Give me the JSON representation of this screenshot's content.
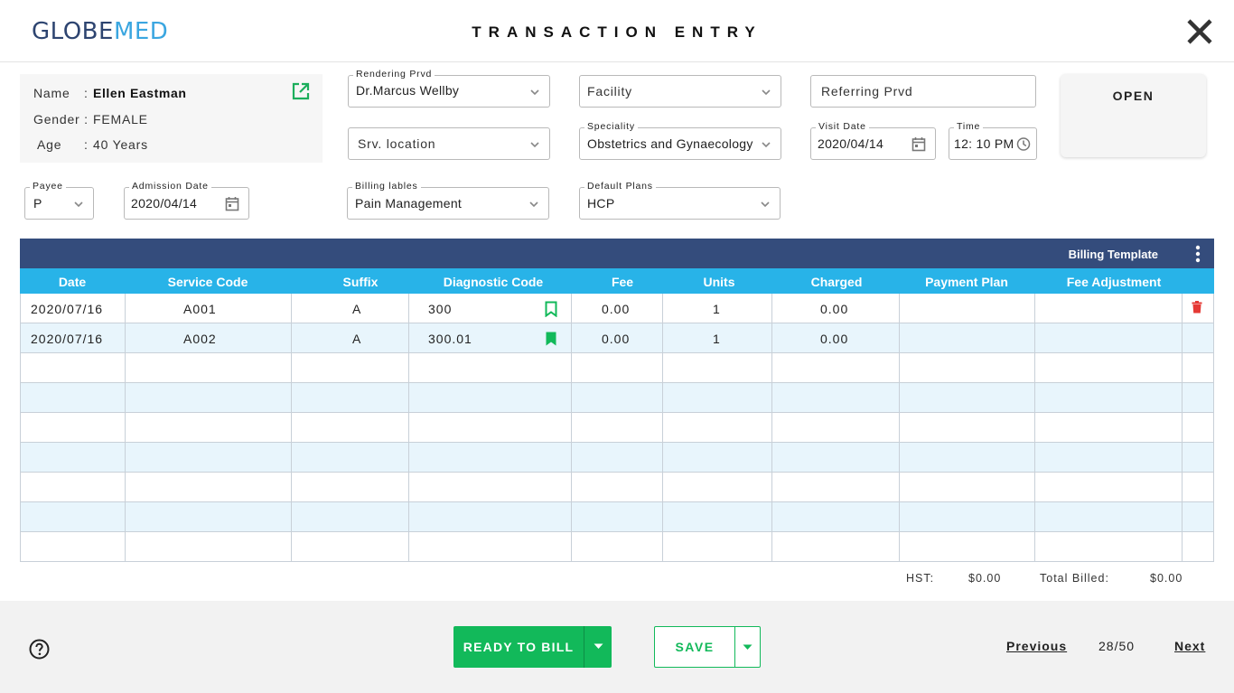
{
  "header": {
    "logo_part1": "GLOBE",
    "logo_part2": "MED",
    "title": "TRANSACTION ENTRY"
  },
  "patient": {
    "name_label": "Name",
    "name_sep": ":",
    "name": "Ellen Eastman",
    "gender_label": "Gender :",
    "gender": "FEMALE",
    "age_label": "Age",
    "age_sep": ":",
    "age": "40 Years"
  },
  "fields": {
    "rendering_prvd": {
      "label": "Rendering Prvd",
      "value": "Dr.Marcus Wellby"
    },
    "facility": {
      "placeholder": "Facility"
    },
    "referring_prvd": {
      "placeholder": "Referring Prvd"
    },
    "srv_location": {
      "placeholder": "Srv. location"
    },
    "speciality": {
      "label": "Speciality",
      "value": "Obstetrics and Gynaecology"
    },
    "visit_date": {
      "label": "Visit Date",
      "value": "2020/04/14"
    },
    "time": {
      "label": "Time",
      "value": "12: 10 PM"
    },
    "payee": {
      "label": "Payee",
      "value": "P"
    },
    "admission_date": {
      "label": "Admission Date",
      "value": "2020/04/14"
    },
    "billing_labels": {
      "label": "Billing lables",
      "value": "Pain Management"
    },
    "default_plans": {
      "label": "Default Plans",
      "value": "HCP"
    }
  },
  "open_button": "OPEN",
  "table": {
    "toolbar_label": "Billing Template",
    "columns": [
      "Date",
      "Service Code",
      "Suffix",
      "Diagnostic Code",
      "Fee",
      "Units",
      "Charged",
      "Payment Plan",
      "Fee Adjustment"
    ],
    "rows": [
      {
        "date": "2020/07/16",
        "service_code": "A001",
        "suffix": "A",
        "diagnostic_code": "300",
        "fee": "0.00",
        "units": "1",
        "charged": "0.00",
        "payment_plan": "",
        "fee_adjustment": ""
      },
      {
        "date": "2020/07/16",
        "service_code": "A002",
        "suffix": "A",
        "diagnostic_code": "300.01",
        "fee": "0.00",
        "units": "1",
        "charged": "0.00",
        "payment_plan": "",
        "fee_adjustment": ""
      }
    ]
  },
  "totals": {
    "hst_label": "HST:",
    "hst_value": "$0.00",
    "total_label": "Total Billed:",
    "total_value": "$0.00"
  },
  "footer": {
    "ready_to_bill": "READY TO BILL",
    "save": "SAVE",
    "previous": "Previous",
    "page": "28/50",
    "next": "Next"
  },
  "colors": {
    "brand_dark": "#2d4470",
    "brand_light": "#3aa6e0",
    "table_toolbar": "#344c7c",
    "table_header": "#28b3e8",
    "accent_green": "#12b95a",
    "delete_red": "#e53935"
  }
}
